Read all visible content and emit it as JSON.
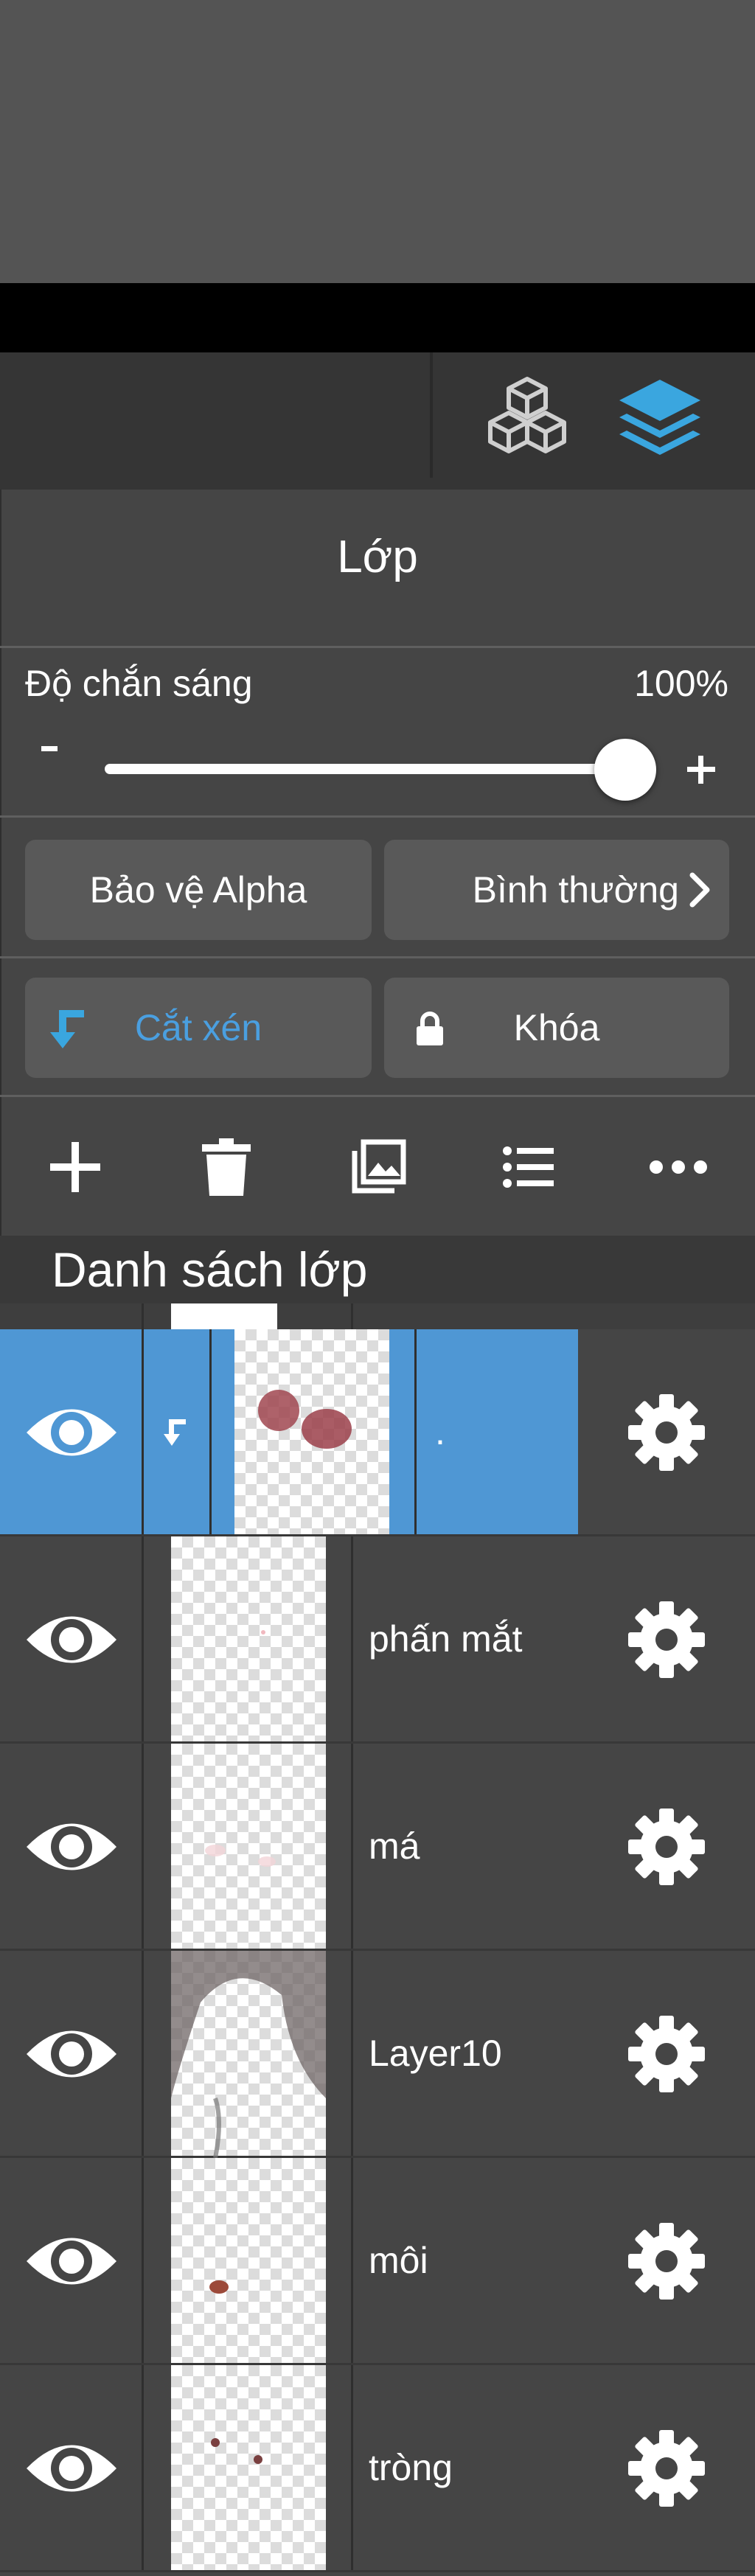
{
  "panel": {
    "title": "Lớp",
    "opacity_label": "Độ chắn sáng",
    "opacity_value": "100%",
    "opacity_level": 1.0,
    "minus_label": "-",
    "plus_label": "+"
  },
  "buttons": {
    "alpha_protect": "Bảo vệ Alpha",
    "blend_mode": "Bình thường",
    "clipping": "Cắt xén",
    "lock": "Khóa"
  },
  "section": {
    "title": "Danh sách lớp"
  },
  "layers": [
    {
      "name": ".",
      "selected": true,
      "clipped": true
    },
    {
      "name": "phấn mắt",
      "selected": false
    },
    {
      "name": "má",
      "selected": false
    },
    {
      "name": "Layer10",
      "selected": false
    },
    {
      "name": "môi",
      "selected": false
    },
    {
      "name": "tròng",
      "selected": false
    }
  ],
  "colors": {
    "accent": "#4f97d4",
    "clip_text": "#4a9fe0",
    "panel_bg": "#454545",
    "button_bg": "#595959"
  },
  "icons": {
    "tab_materials": "cubes-icon",
    "tab_layers": "layers-icon",
    "add": "plus-icon",
    "delete": "trash-icon",
    "import": "image-stack-icon",
    "list": "list-icon",
    "more": "ellipsis-icon"
  }
}
